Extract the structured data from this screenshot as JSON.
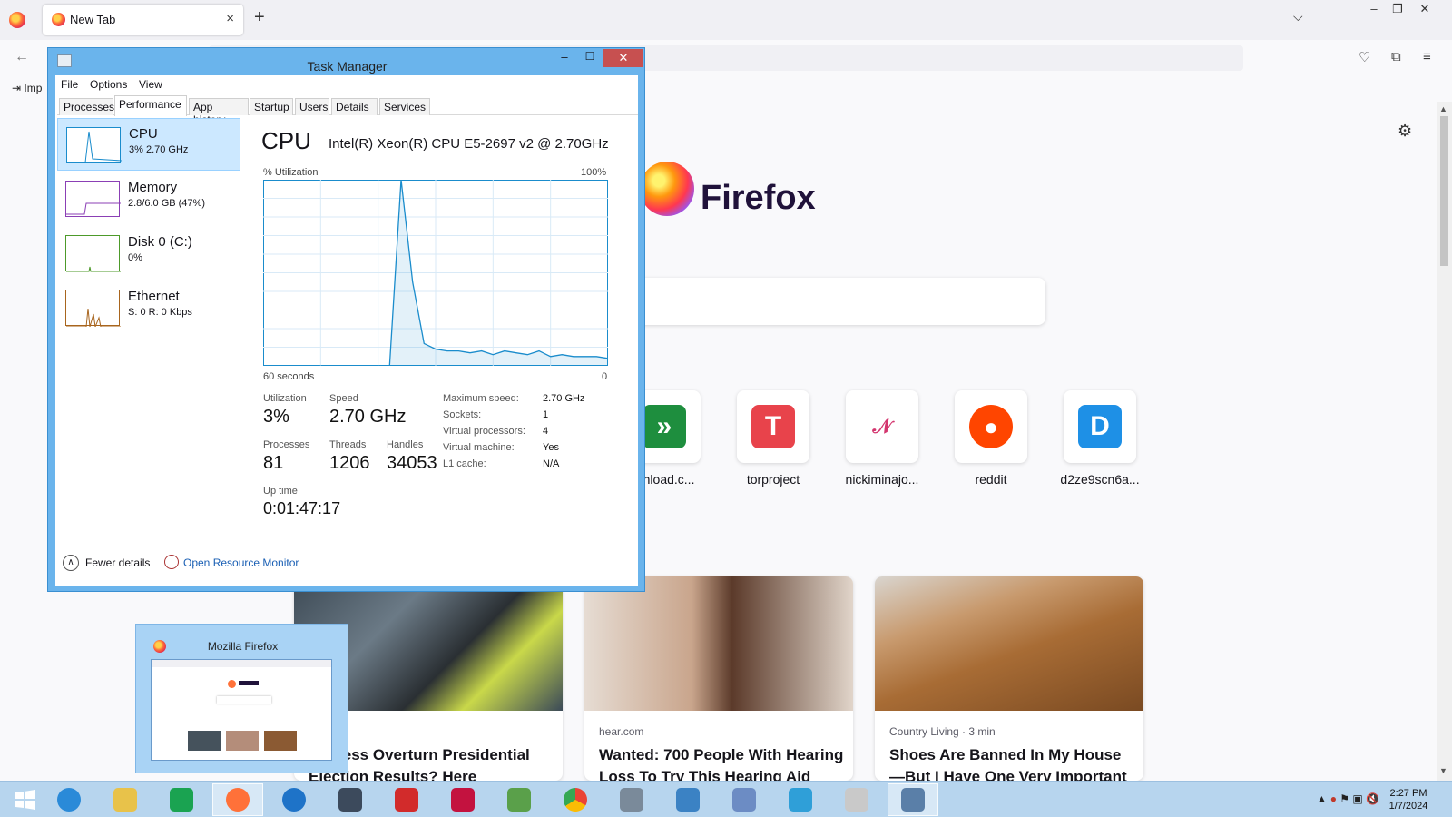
{
  "browser": {
    "tab_title": "New Tab",
    "tab_close": "×",
    "new_tab": "+",
    "bookmark_import_label": "Imp",
    "window_controls": [
      "–",
      "❐",
      "✕"
    ]
  },
  "newtab": {
    "wordmark": "Firefox",
    "topsites": [
      {
        "label": "wnload.c...",
        "glyph": "»",
        "color": "#1e8e3e"
      },
      {
        "label": "torproject",
        "glyph": "T",
        "color": "#e8434b"
      },
      {
        "label": "nickiminajo...",
        "glyph": "𝒩",
        "color": "#ffffff"
      },
      {
        "label": "reddit",
        "glyph": "●",
        "color": "#ff4500"
      },
      {
        "label": "d2ze9scn6a...",
        "glyph": "D",
        "color": "#1e90e6"
      }
    ],
    "stories": [
      {
        "source": "DAY",
        "title": "ongress Overturn Presidential Election Results? Here"
      },
      {
        "source": "hear.com",
        "title": "Wanted: 700 People With Hearing Loss To Try This Hearing Aid"
      },
      {
        "source": "Country Living · 3 min",
        "title": "Shoes Are Banned In My House—But I Have One Very Important"
      }
    ]
  },
  "task_manager": {
    "title": "Task Manager",
    "menu": [
      "File",
      "Options",
      "View"
    ],
    "tabs": [
      "Processes",
      "Performance",
      "App history",
      "Startup",
      "Users",
      "Details",
      "Services"
    ],
    "active_tab": "Performance",
    "resources": [
      {
        "name": "CPU",
        "value": "3% 2.70 GHz",
        "color": "#1a8ccc"
      },
      {
        "name": "Memory",
        "value": "2.8/6.0 GB (47%)",
        "color": "#8b3fb5"
      },
      {
        "name": "Disk 0 (C:)",
        "value": "0%",
        "color": "#4d9a2a"
      },
      {
        "name": "Ethernet",
        "value": "S: 0 R: 0 Kbps",
        "color": "#a8651e"
      }
    ],
    "perf": {
      "title": "CPU",
      "model": "Intel(R) Xeon(R) CPU E5-2697 v2 @ 2.70GHz",
      "util_label": "% Utilization",
      "util_max": "100%",
      "time_left": "60 seconds",
      "time_right": "0",
      "stats": {
        "utilization_label": "Utilization",
        "utilization": "3%",
        "speed_label": "Speed",
        "speed": "2.70 GHz",
        "processes_label": "Processes",
        "processes": "81",
        "threads_label": "Threads",
        "threads": "1206",
        "handles_label": "Handles",
        "handles": "34053",
        "uptime_label": "Up time",
        "uptime": "0:01:47:17"
      },
      "details": [
        {
          "k": "Maximum speed:",
          "v": "2.70 GHz"
        },
        {
          "k": "Sockets:",
          "v": "1"
        },
        {
          "k": "Virtual processors:",
          "v": "4"
        },
        {
          "k": "Virtual machine:",
          "v": "Yes"
        },
        {
          "k": "L1 cache:",
          "v": "N/A"
        }
      ]
    },
    "footer": {
      "fewer": "Fewer details",
      "resmon": "Open Resource Monitor"
    }
  },
  "chart_data": {
    "type": "area",
    "title": "CPU",
    "ylabel": "% Utilization",
    "ylim": [
      0,
      100
    ],
    "xlabel": "60 seconds",
    "x": [
      60,
      58,
      56,
      54,
      52,
      50,
      48,
      46,
      44,
      42,
      40,
      38,
      36,
      34,
      32,
      30,
      28,
      26,
      24,
      22,
      20,
      18,
      16,
      14,
      12,
      10,
      8,
      6,
      4,
      2,
      0
    ],
    "series": [
      {
        "values": [
          0,
          0,
          0,
          0,
          0,
          0,
          0,
          0,
          0,
          0,
          0,
          0,
          100,
          45,
          12,
          9,
          8,
          8,
          7,
          8,
          6,
          8,
          7,
          6,
          8,
          5,
          6,
          5,
          5,
          5,
          4
        ]
      }
    ],
    "grid": true
  },
  "preview": {
    "title": "Mozilla Firefox"
  },
  "taskbar": {
    "apps": [
      "start",
      "internet-explorer",
      "file-explorer",
      "store",
      "firefox",
      "edge",
      "remote-desktop",
      "settings-app",
      "screen-recorder",
      "paint-app",
      "chrome",
      "notes-app",
      "control-panel",
      "calendar-app",
      "downloader",
      "document-app",
      "task-manager"
    ],
    "clock_time": "2:27 PM",
    "clock_date": "1/7/2024"
  }
}
